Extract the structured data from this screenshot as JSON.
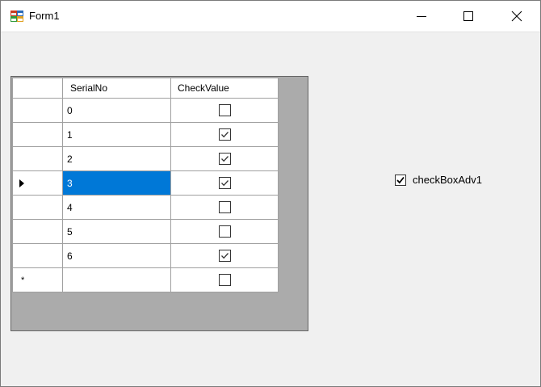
{
  "window": {
    "title": "Form1"
  },
  "grid": {
    "columns": {
      "serial": "SerialNo",
      "check": "CheckValue"
    },
    "current_row_index": 3,
    "rows": [
      {
        "serial": "0",
        "checked": false
      },
      {
        "serial": "1",
        "checked": true
      },
      {
        "serial": "2",
        "checked": true
      },
      {
        "serial": "3",
        "checked": true
      },
      {
        "serial": "4",
        "checked": false
      },
      {
        "serial": "5",
        "checked": false
      },
      {
        "serial": "6",
        "checked": true
      }
    ],
    "new_row": {
      "serial": "",
      "checked": false,
      "marker": "*"
    }
  },
  "checkbox_adv": {
    "label": "checkBoxAdv1",
    "checked": true
  },
  "colors": {
    "selection": "#0078d7",
    "grid_background": "#ababab"
  }
}
